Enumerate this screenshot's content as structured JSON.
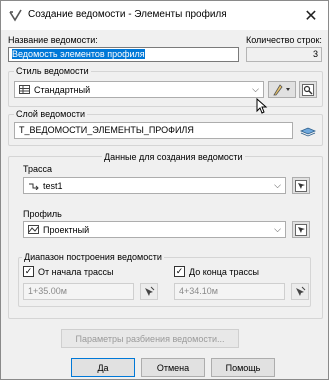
{
  "window": {
    "title": "Создание ведомости - Элементы профиля",
    "close_glyph": "✕"
  },
  "name_label": "Название ведомости:",
  "count_label": "Количество строк:",
  "name_value": "Ведомость элементов профиля",
  "count_value": "3",
  "style_group": {
    "title": "Стиль ведомости",
    "selected": "Стандартный"
  },
  "layer_group": {
    "title": "Слой ведомости",
    "value": "Т_ВЕДОМОСТИ_ЭЛЕМЕНТЫ_ПРОФИЛЯ"
  },
  "data_group": {
    "title": "Данные для создания ведомости",
    "route_label": "Трасса",
    "route_value": "test1",
    "profile_label": "Профиль",
    "profile_value": "Проектный",
    "range_label": "Диапазон построения ведомости",
    "from_start_label": "От начала трассы",
    "to_end_label": "До конца трассы",
    "from_start_checked": true,
    "to_end_checked": true,
    "from_value": "1+35.00м",
    "to_value": "4+34.10м"
  },
  "split_params_button": "Параметры разбиения ведомости...",
  "buttons": {
    "ok": "Да",
    "cancel": "Отмена",
    "help": "Помощь"
  },
  "colors": {
    "selection": "#0078d7",
    "dialog_bg": "#f0f0f0"
  }
}
